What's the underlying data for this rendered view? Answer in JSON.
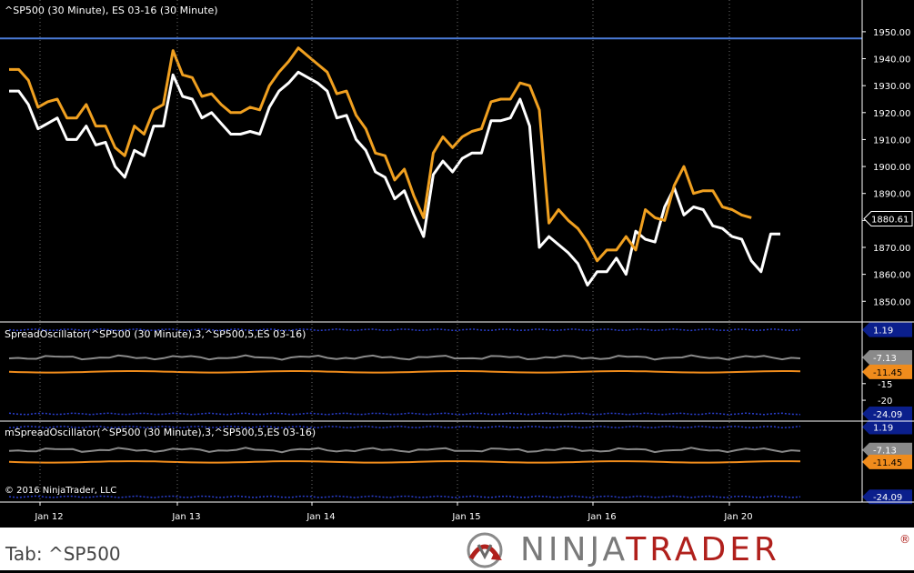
{
  "panels": {
    "price": {
      "title": "^SP500 (30 Minute), ES 03-16 (30 Minute)",
      "axis_ticks": [
        "1950.00",
        "1940.00",
        "1930.00",
        "1920.00",
        "1910.00",
        "1900.00",
        "1890.00",
        "1880.00",
        "1870.00",
        "1860.00",
        "1850.00"
      ],
      "last_value_label": "1880.61"
    },
    "osc1": {
      "title": "SpreadOscillator(^SP500 (30 Minute),3,^SP500,5,ES 03-16)",
      "axis_ticks": [
        "-15",
        "-20"
      ],
      "markers": [
        "1.19",
        "-7.13",
        "-11.45",
        "-24.09"
      ]
    },
    "osc2": {
      "title": "mSpreadOscillator(^SP500 (30 Minute),3,^SP500,5,ES 03-16)",
      "axis_ticks": [],
      "markers": [
        "1.19",
        "-7.13",
        "-11.45",
        "-24.09"
      ],
      "copyright": "© 2016 NinjaTrader, LLC"
    }
  },
  "x_axis_labels": [
    "Jan 12",
    "Jan 13",
    "Jan 14",
    "Jan 15",
    "Jan 16",
    "Jan 20"
  ],
  "footer": {
    "tab_label": "Tab: ^SP500",
    "logo_ninja": "NINJA",
    "logo_trader": "TRADER",
    "logo_reg": "®"
  },
  "colors": {
    "background": "#000000",
    "sp500_line": "#ffffff",
    "es_line": "#f0a020",
    "blue_line": "#4a7bd8",
    "gray_line": "#8a8a8a",
    "orange_line": "#f08c1c",
    "marker_blue": "#0b1f8c",
    "marker_gray": "#8a8a8a",
    "marker_orange": "#f08c1c"
  },
  "chart_data": {
    "type": "line",
    "x_labels": [
      "Jan 12",
      "Jan 13",
      "Jan 14",
      "Jan 15",
      "Jan 16",
      "Jan 20"
    ],
    "ylim": [
      1843,
      1953
    ],
    "y_ticks": [
      1950,
      1940,
      1930,
      1920,
      1910,
      1900,
      1890,
      1880,
      1870,
      1860,
      1850
    ],
    "grid": true,
    "reference_line": 1947.5,
    "series": [
      {
        "name": "^SP500",
        "color": "#ffffff",
        "values": [
          1928,
          1928,
          1923,
          1914,
          1916,
          1918,
          1910,
          1910,
          1915,
          1908,
          1909,
          1900,
          1896,
          1906,
          1904,
          1915,
          1915,
          1934,
          1926,
          1925,
          1918,
          1920,
          1916,
          1912,
          1912,
          1913,
          1912,
          1922,
          1928,
          1931,
          1935,
          1933,
          1931,
          1928,
          1918,
          1919,
          1910,
          1906,
          1898,
          1896,
          1888,
          1891,
          1882,
          1874,
          1897,
          1902,
          1898,
          1903,
          1905,
          1905,
          1917,
          1917,
          1918,
          1925,
          1915,
          1870,
          1874,
          1871,
          1868,
          1864,
          1856,
          1861,
          1861,
          1866,
          1860,
          1876,
          1873,
          1872,
          1885,
          1892,
          1882,
          1885,
          1884,
          1878,
          1877,
          1874,
          1873,
          1865,
          1861,
          1875,
          1875
        ]
      },
      {
        "name": "ES 03-16",
        "color": "#f0a020",
        "values": [
          1936,
          1936,
          1932,
          1922,
          1924,
          1925,
          1918,
          1918,
          1923,
          1915,
          1915,
          1907,
          1904,
          1915,
          1912,
          1921,
          1923,
          1943,
          1934,
          1933,
          1926,
          1927,
          1923,
          1920,
          1920,
          1922,
          1921,
          1930,
          1935,
          1939,
          1944,
          1941,
          1938,
          1935,
          1927,
          1928,
          1919,
          1914,
          1905,
          1904,
          1895,
          1899,
          1889,
          1881,
          1905,
          1911,
          1907,
          1911,
          1913,
          1914,
          1924,
          1925,
          1925,
          1931,
          1930,
          1921,
          1879,
          1884,
          1880,
          1877,
          1872,
          1865,
          1869,
          1869,
          1874,
          1869,
          1884,
          1881,
          1880,
          1893,
          1900,
          1890,
          1891,
          1891,
          1885,
          1884,
          1882,
          1881
        ]
      }
    ],
    "oscillators": [
      {
        "title": "SpreadOscillator(^SP500 (30 Minute),3,^SP500,5,ES 03-16)",
        "upper_band": 1.19,
        "spread": -7.13,
        "signal": -11.45,
        "lower_band": -24.09,
        "ylim": [
          -26,
          3
        ],
        "y_ticks": [
          -15,
          -20
        ]
      },
      {
        "title": "mSpreadOscillator(^SP500 (30 Minute),3,^SP500,5,ES 03-16)",
        "upper_band": 1.19,
        "spread": -7.13,
        "signal": -11.45,
        "lower_band": -24.09,
        "ylim": [
          -26,
          3
        ],
        "y_ticks": []
      }
    ]
  }
}
